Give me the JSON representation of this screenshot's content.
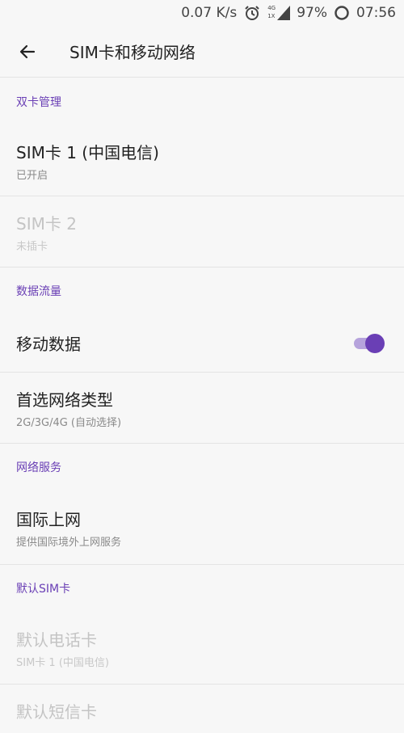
{
  "status_bar": {
    "net_speed": "0.07 K/s",
    "signal_top": "4G",
    "signal_bottom": "1X",
    "battery": "97%",
    "time": "07:56"
  },
  "toolbar": {
    "title": "SIM卡和移动网络"
  },
  "sections": {
    "dual_sim": {
      "header": "双卡管理",
      "sim1": {
        "title": "SIM卡 1 (中国电信)",
        "subtitle": "已开启"
      },
      "sim2": {
        "title": "SIM卡 2",
        "subtitle": "未插卡"
      }
    },
    "data": {
      "header": "数据流量",
      "mobile_data": {
        "title": "移动数据",
        "enabled": true
      },
      "network_type": {
        "title": "首选网络类型",
        "subtitle": "2G/3G/4G (自动选择)"
      }
    },
    "network_service": {
      "header": "网络服务",
      "roaming": {
        "title": "国际上网",
        "subtitle": "提供国际境外上网服务"
      }
    },
    "default_sim": {
      "header": "默认SIM卡",
      "call_card": {
        "title": "默认电话卡",
        "subtitle": "SIM卡 1 (中国电信)"
      },
      "sms_card": {
        "title": "默认短信卡"
      }
    }
  },
  "colors": {
    "accent": "#6a3fb5",
    "background": "#f7f7f7",
    "disabled_text": "#c4c4c4"
  },
  "icons": [
    "arrow-left-icon",
    "alarm-clock-icon",
    "signal-icon",
    "battery-ring-icon"
  ]
}
